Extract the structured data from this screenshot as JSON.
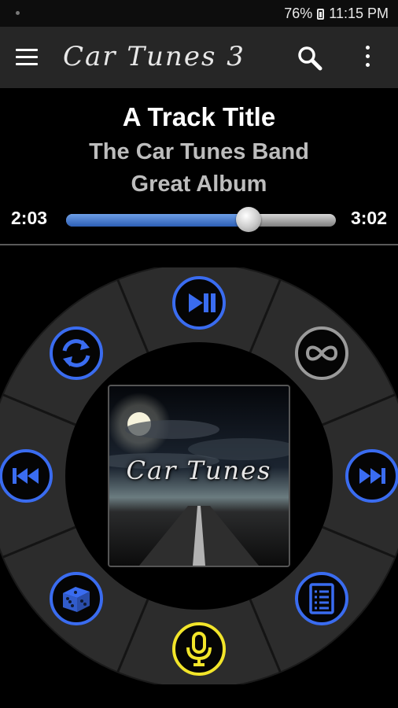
{
  "status": {
    "battery": "76%",
    "time": "11:15 PM"
  },
  "app": {
    "title": "Car Tunes 3"
  },
  "track": {
    "title": "A Track Title",
    "artist": "The Car Tunes Band",
    "album": "Great Album"
  },
  "progress": {
    "elapsed": "2:03",
    "total": "3:02",
    "fraction": 0.675
  },
  "album_art": {
    "caption": "Car Tunes"
  },
  "controls": [
    {
      "name": "play-pause-button",
      "icon": "play-pause-icon",
      "color": "#3a6cf0"
    },
    {
      "name": "infinite-loop-button",
      "icon": "infinity-icon",
      "color": "#9a9a9a"
    },
    {
      "name": "next-track-button",
      "icon": "skip-next-icon",
      "color": "#3a6cf0"
    },
    {
      "name": "playlist-button",
      "icon": "list-icon",
      "color": "#3a6cf0"
    },
    {
      "name": "voice-command-button",
      "icon": "microphone-icon",
      "color": "#f2e52a"
    },
    {
      "name": "shuffle-button",
      "icon": "dice-icon",
      "color": "#3a6cf0"
    },
    {
      "name": "previous-track-button",
      "icon": "skip-previous-icon",
      "color": "#3a6cf0"
    },
    {
      "name": "repeat-button",
      "icon": "repeat-icon",
      "color": "#3a6cf0"
    }
  ]
}
